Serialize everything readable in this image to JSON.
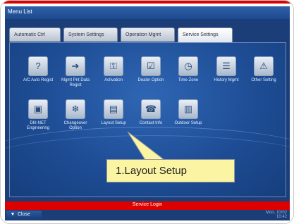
{
  "window": {
    "title": "Menu List"
  },
  "tabs": [
    {
      "label": "Automatic Ctrl"
    },
    {
      "label": "System Settings"
    },
    {
      "label": "Operation Mgmt"
    },
    {
      "label": "Service Settings"
    }
  ],
  "items": [
    {
      "label": "A/C Auto Regist",
      "icon": "ac-register-icon",
      "glyph": "?"
    },
    {
      "label": "Mgmt Pnt Data Regist",
      "icon": "management-point-icon",
      "glyph": "➔"
    },
    {
      "label": "Activation",
      "icon": "key-icon",
      "glyph": "⚿"
    },
    {
      "label": "Dealer Option",
      "icon": "checkbox-icon",
      "glyph": "☑"
    },
    {
      "label": "Time Zone",
      "icon": "world-clock-icon",
      "glyph": "◷"
    },
    {
      "label": "History Mgmt",
      "icon": "history-icon",
      "glyph": "☰"
    },
    {
      "label": "Other Setting",
      "icon": "warning-icon",
      "glyph": "⚠"
    },
    {
      "label": "DIII-NET Engineering",
      "icon": "network-icon",
      "glyph": "▣"
    },
    {
      "label": "Changeover Option",
      "icon": "changeover-icon",
      "glyph": "❄"
    },
    {
      "label": "Layout Setup",
      "icon": "layout-icon",
      "glyph": "▤"
    },
    {
      "label": "Contact Info",
      "icon": "contact-icon",
      "glyph": "☎"
    },
    {
      "label": "Outdoor Setup",
      "icon": "outdoor-unit-icon",
      "glyph": "▥"
    }
  ],
  "service_login": "Service Login",
  "close_label": "Close",
  "clock": {
    "date": "Mon, 10/02",
    "time": "10:42"
  },
  "callout": "1.Layout Setup",
  "colors": {
    "accent_red": "#dd0000",
    "panel_blue": "#1e4d95",
    "callout_yellow": "#fbf4a3"
  }
}
